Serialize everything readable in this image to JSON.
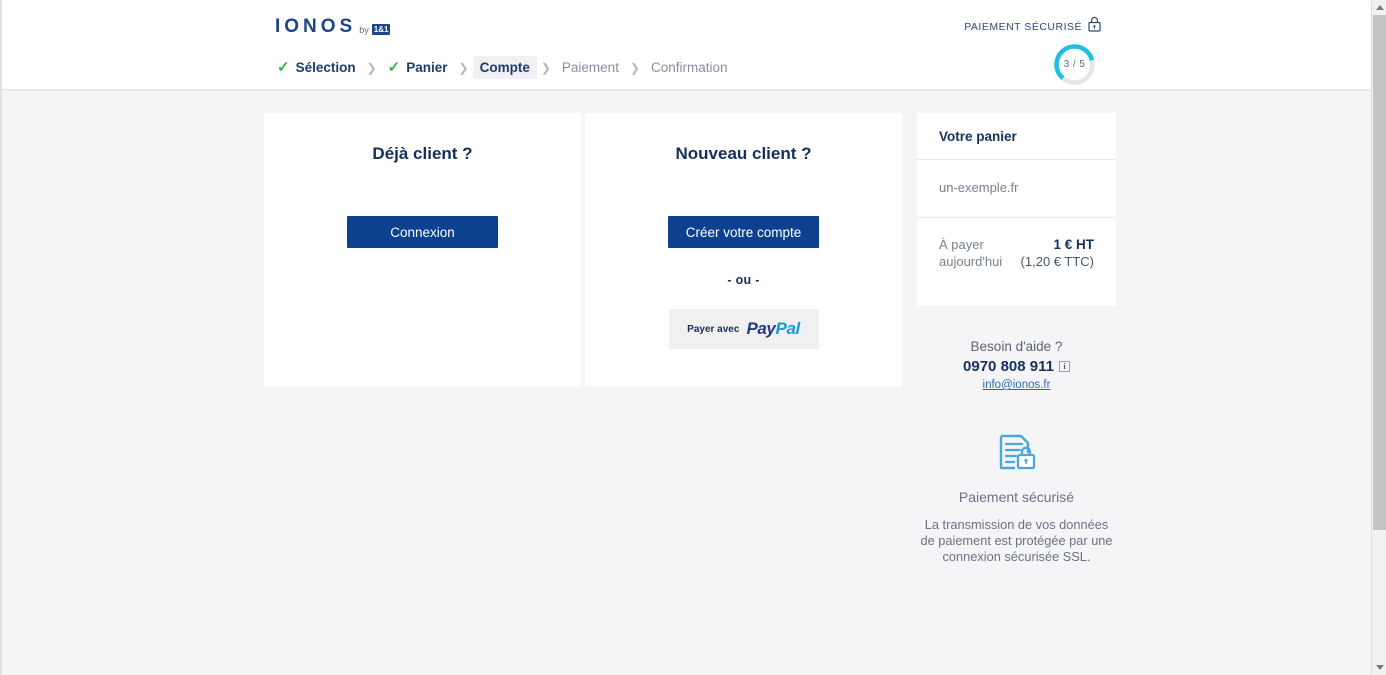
{
  "header": {
    "logo": {
      "word": "IONOS",
      "by": "by",
      "badge": "1&1"
    },
    "secure": {
      "label": "PAIEMENT SÉCURISÉ",
      "icon": "lock-icon"
    },
    "progress": {
      "text": "3 / 5",
      "current": 3,
      "total": 5,
      "percent": 60,
      "color": "#1ebfe0",
      "track": "#e3e5ea"
    },
    "breadcrumb": [
      {
        "label": "Sélection",
        "state": "done",
        "check": "✓"
      },
      {
        "label": "Panier",
        "state": "done",
        "check": "✓"
      },
      {
        "label": "Compte",
        "state": "active",
        "check": ""
      },
      {
        "label": "Paiement",
        "state": "todo",
        "check": ""
      },
      {
        "label": "Confirmation",
        "state": "todo",
        "check": ""
      }
    ],
    "separator": "❯"
  },
  "existing_customer": {
    "title": "Déjà client ?",
    "login_button": "Connexion"
  },
  "new_customer": {
    "title": "Nouveau client ?",
    "create_button": "Créer votre compte",
    "or_divider": "- ou -",
    "paypal": {
      "prefix": "Payer avec",
      "logo_part1": "Pay",
      "logo_part2": "Pal"
    }
  },
  "cart": {
    "title": "Votre panier",
    "item": "un-exemple.fr",
    "total_label_line1": "À payer",
    "total_label_line2": "aujourd'hui",
    "total_ht": "1 € HT",
    "total_ttc": "(1,20 € TTC)"
  },
  "help": {
    "title": "Besoin d'aide ?",
    "phone": "0970 808 911",
    "info_icon": "i",
    "email": "info@ionos.fr"
  },
  "ssl": {
    "icon": "document-lock-icon",
    "title": "Paiement sécurisé",
    "description": "La transmission de vos données de paiement est protégée par une connexion sécurisée SSL.",
    "color": "#4aa8dc"
  },
  "colors": {
    "brand_navy": "#1d4585",
    "button_blue": "#0c4190",
    "accent_cyan": "#1ebfe0",
    "check_green": "#2db84c",
    "page_bg": "#f5f5f8"
  }
}
